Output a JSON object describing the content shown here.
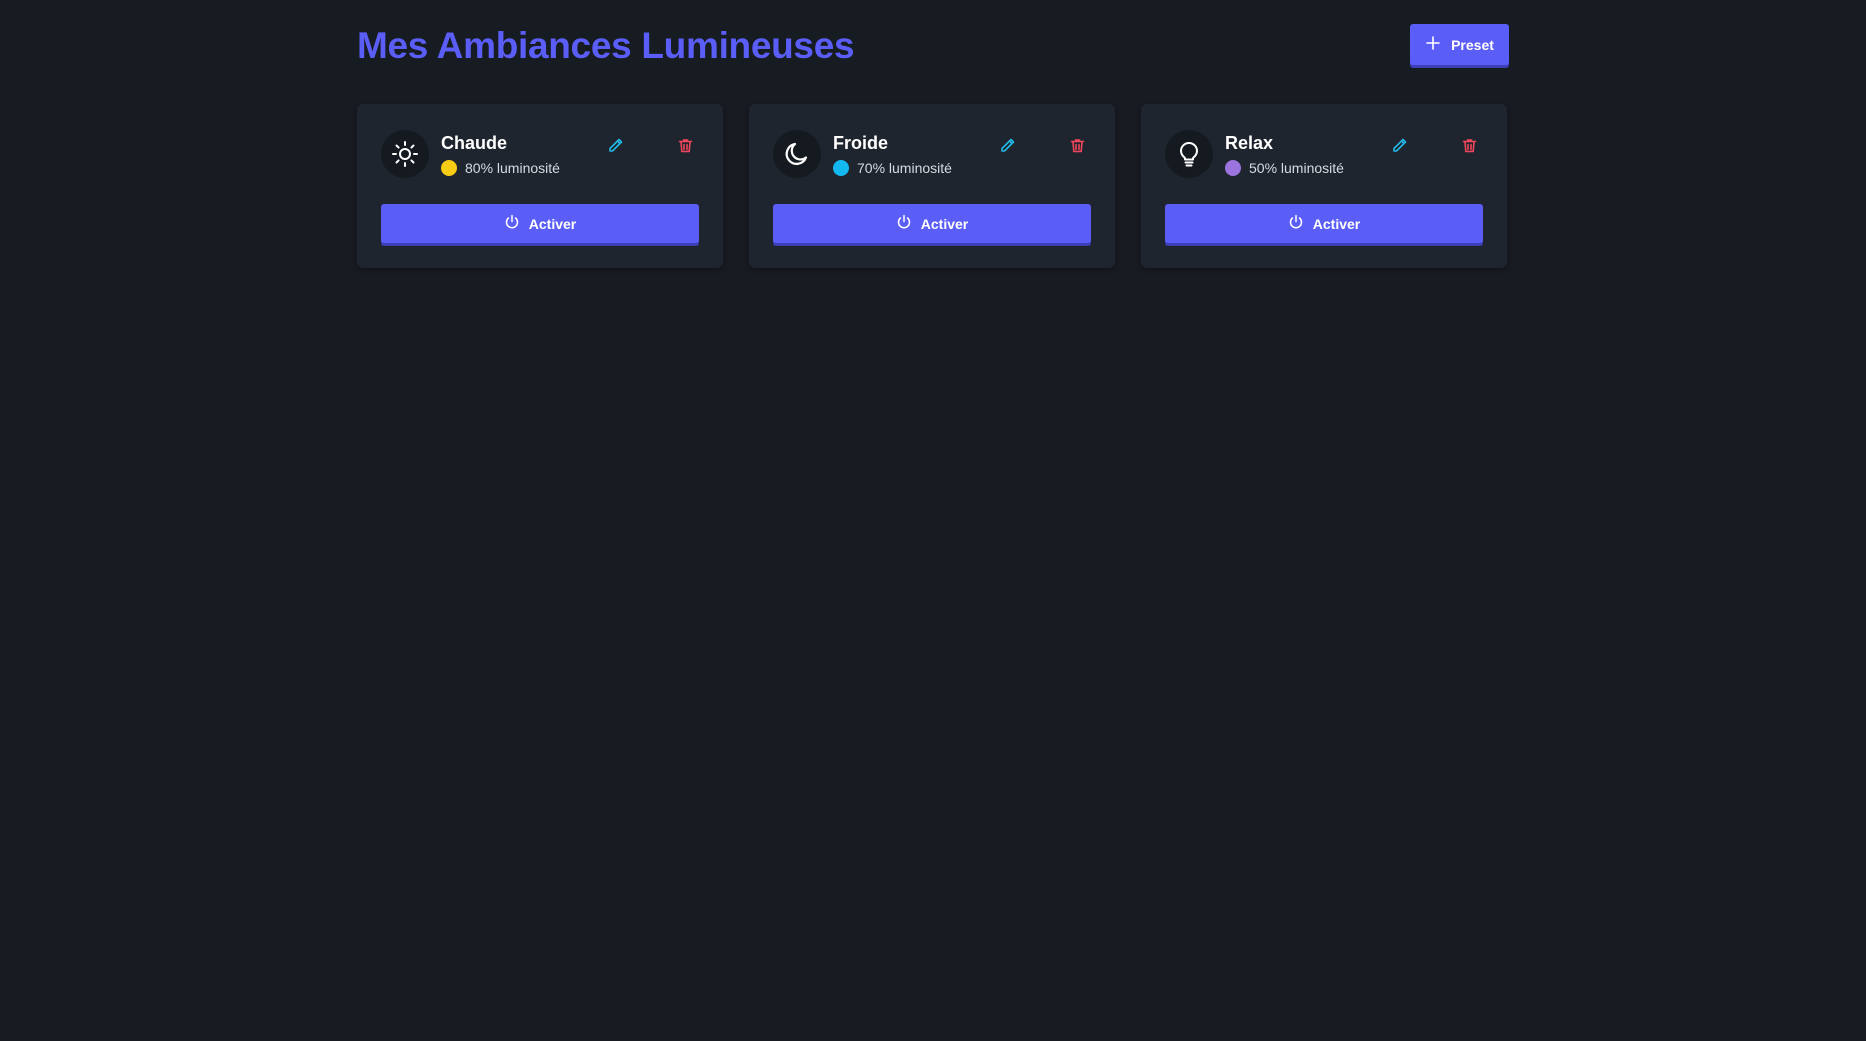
{
  "header": {
    "title": "Mes Ambiances Lumineuses",
    "add_button_label": "Preset",
    "add_button_icon": "plus-icon"
  },
  "colors": {
    "accent": "#5b5ef6",
    "background": "#171b22",
    "card_background": "#1f252e",
    "edit_icon": "#22b8e6",
    "delete_icon": "#f0465c"
  },
  "presets": [
    {
      "name": "Chaude",
      "icon": "sun-icon",
      "dot_color": "#f7cc14",
      "brightness_text": "80% luminosité",
      "brightness": 80,
      "activate_label": "Activer"
    },
    {
      "name": "Froide",
      "icon": "moon-icon",
      "dot_color": "#14b8f0",
      "brightness_text": "70% luminosité",
      "brightness": 70,
      "activate_label": "Activer"
    },
    {
      "name": "Relax",
      "icon": "lightbulb-icon",
      "dot_color": "#9b74e0",
      "brightness_text": "50% luminosité",
      "brightness": 50,
      "activate_label": "Activer"
    }
  ]
}
